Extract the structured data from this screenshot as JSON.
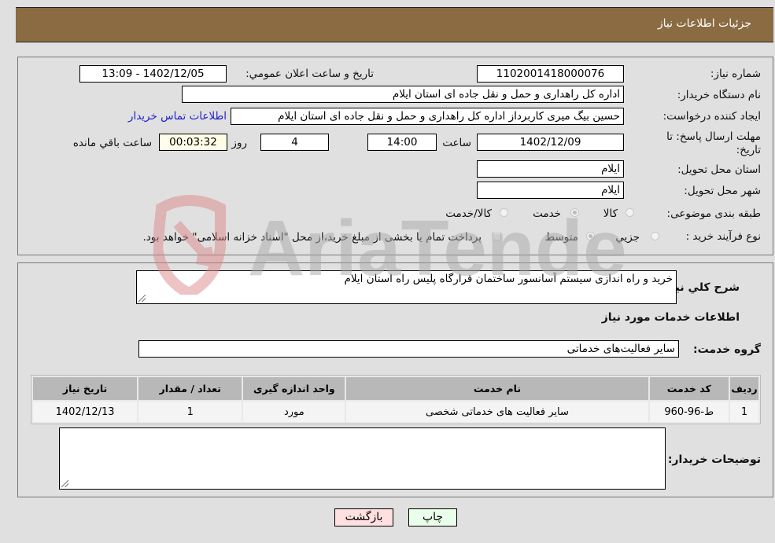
{
  "header": {
    "title": "جزئیات اطلاعات نیاز"
  },
  "form": {
    "need_number_label": "شماره نیاز:",
    "need_number": "1102001418000076",
    "announce_label": "تاریخ و ساعت اعلان عمومي:",
    "announce_value": "1402/12/05 - 13:09",
    "buyer_org_label": "نام دستگاه خریدار:",
    "buyer_org": "اداره کل راهداری و حمل و نقل جاده ای استان ایلام",
    "creator_label": "ایجاد کننده درخواست:",
    "creator": "حسین بیگ میری کاربرداز اداره کل راهداری و حمل و نقل جاده ای استان ایلام",
    "contact_link": "اطلاعات تماس خریدار",
    "deadline_label": "مهلت ارسال پاسخ: تا تاریخ:",
    "deadline_date": "1402/12/09",
    "time_label": "ساعت",
    "deadline_time": "14:00",
    "days_value": "4",
    "days_label": "روز و",
    "remaining_value": "00:03:32",
    "remaining_label": "ساعت باقي مانده",
    "province_label": "استان محل تحویل:",
    "province": "ایلام",
    "city_label": "شهر محل تحویل:",
    "city": "ایلام",
    "category_label": "طبقه بندی موضوعی:",
    "category_options": [
      {
        "label": "کالا",
        "selected": false
      },
      {
        "label": "خدمت",
        "selected": true
      },
      {
        "label": "کالا/خدمت",
        "selected": false
      }
    ],
    "process_label": "نوع فرآیند خرید :",
    "process_options": [
      {
        "label": "جزيي",
        "selected": false
      },
      {
        "label": "متوسط",
        "selected": true
      }
    ],
    "treasury_text": "پرداخت تمام یا بخشی از مبلغ خرید،از محل \"اسناد خزانه اسلامی\" خواهد بود.",
    "treasury_checked": false
  },
  "details": {
    "summary_label": "شرح كلي نیاز:",
    "summary": "خرید و راه اندازی سیستم آسانسور ساختمان قرارگاه پلیس راه استان ایلام",
    "services_heading": "اطلاعات خدمات مورد نیاز",
    "service_group_label": "گروه خدمت:",
    "service_group": "سایر فعالیت‌های خدماتی",
    "table": {
      "headers": [
        "ردیف",
        "کد خدمت",
        "نام خدمت",
        "واحد اندازه گیری",
        "تعداد / مقدار",
        "تاریخ نیاز"
      ],
      "rows": [
        [
          "1",
          "ط-96-960",
          "سایر فعالیت های خدماتی شخصی",
          "مورد",
          "1",
          "1402/12/13"
        ]
      ]
    },
    "buyer_notes_label": "توضیحات خریدار:",
    "buyer_notes": ""
  },
  "buttons": {
    "print": "چاپ",
    "back": "بازگشت"
  },
  "watermark": "AriaTender.neT"
}
